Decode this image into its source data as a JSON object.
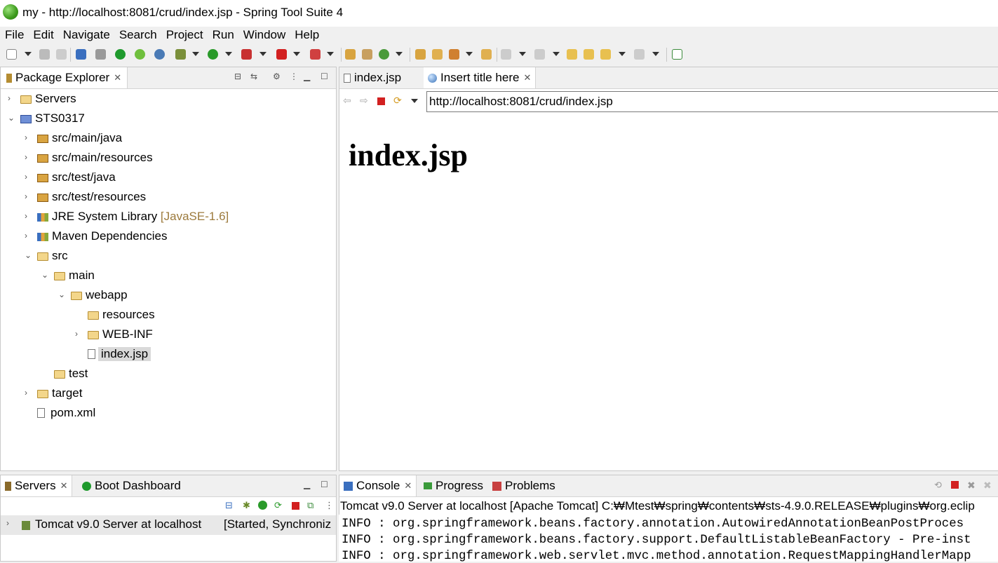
{
  "window": {
    "title": "my - http://localhost:8081/crud/index.jsp - Spring Tool Suite 4"
  },
  "menu": [
    "File",
    "Edit",
    "Navigate",
    "Search",
    "Project",
    "Run",
    "Window",
    "Help"
  ],
  "package_explorer": {
    "tab_label": "Package Explorer",
    "tree": [
      {
        "label": "Servers",
        "decoration": "",
        "icon": "folder-icon",
        "depth": 0,
        "expanded": false
      },
      {
        "label": "STS0317",
        "decoration": "",
        "icon": "project-icon",
        "depth": 0,
        "expanded": true
      },
      {
        "label": "src/main/java",
        "decoration": "",
        "icon": "source-folder-icon",
        "depth": 1,
        "expanded": false
      },
      {
        "label": "src/main/resources",
        "decoration": "",
        "icon": "source-folder-icon",
        "depth": 1,
        "expanded": false
      },
      {
        "label": "src/test/java",
        "decoration": "",
        "icon": "source-folder-icon",
        "depth": 1,
        "expanded": false
      },
      {
        "label": "src/test/resources",
        "decoration": "",
        "icon": "source-folder-icon",
        "depth": 1,
        "expanded": false
      },
      {
        "label": "JRE System Library",
        "decoration": "[JavaSE-1.6]",
        "icon": "library-icon",
        "depth": 1,
        "expanded": false
      },
      {
        "label": "Maven Dependencies",
        "decoration": "",
        "icon": "library-icon",
        "depth": 1,
        "expanded": false
      },
      {
        "label": "src",
        "decoration": "",
        "icon": "folder-icon",
        "depth": 1,
        "expanded": true
      },
      {
        "label": "main",
        "decoration": "",
        "icon": "folder-icon",
        "depth": 2,
        "expanded": true
      },
      {
        "label": "webapp",
        "decoration": "",
        "icon": "folder-icon",
        "depth": 3,
        "expanded": true
      },
      {
        "label": "resources",
        "decoration": "",
        "icon": "folder-icon",
        "depth": 4,
        "expanded": null
      },
      {
        "label": "WEB-INF",
        "decoration": "",
        "icon": "folder-icon",
        "depth": 4,
        "expanded": false
      },
      {
        "label": "index.jsp",
        "decoration": "",
        "icon": "file-icon",
        "depth": 4,
        "expanded": null,
        "selected": true
      },
      {
        "label": "test",
        "decoration": "",
        "icon": "folder-icon",
        "depth": 2,
        "expanded": null
      },
      {
        "label": "target",
        "decoration": "",
        "icon": "folder-icon",
        "depth": 1,
        "expanded": false
      },
      {
        "label": "pom.xml",
        "decoration": "",
        "icon": "maven-file-icon",
        "depth": 1,
        "expanded": null
      }
    ]
  },
  "editor": {
    "tabs": [
      {
        "label": "index.jsp",
        "icon": "file-icon",
        "active": false
      },
      {
        "label": "Insert title here",
        "icon": "globe-icon",
        "active": true
      }
    ],
    "browser": {
      "url": "http://localhost:8081/crud/index.jsp",
      "heading": "index.jsp"
    }
  },
  "servers_panel": {
    "tabs": [
      {
        "label": "Servers",
        "active": true
      },
      {
        "label": "Boot Dashboard",
        "active": false
      }
    ],
    "server_name": "Tomcat v9.0 Server at localhost",
    "server_status": "[Started, Synchroniz"
  },
  "console_panel": {
    "tabs": [
      {
        "label": "Console",
        "active": true
      },
      {
        "label": "Progress",
        "active": false
      },
      {
        "label": "Problems",
        "active": false
      }
    ],
    "process_label": "Tomcat v9.0 Server at localhost [Apache Tomcat] C:₩Mtest₩spring₩contents₩sts-4.9.0.RELEASE₩plugins₩org.eclip",
    "lines": [
      "INFO : org.springframework.beans.factory.annotation.AutowiredAnnotationBeanPostProces",
      "INFO : org.springframework.beans.factory.support.DefaultListableBeanFactory - Pre-inst",
      "INFO : org.springframework.web.servlet.mvc.method.annotation.RequestMappingHandlerMapp"
    ]
  },
  "colors": {
    "accent_green": "#3d9a1d",
    "stop_red": "#d22020",
    "selection": "#d9d9d9",
    "decoration": "#9c7a3c"
  }
}
